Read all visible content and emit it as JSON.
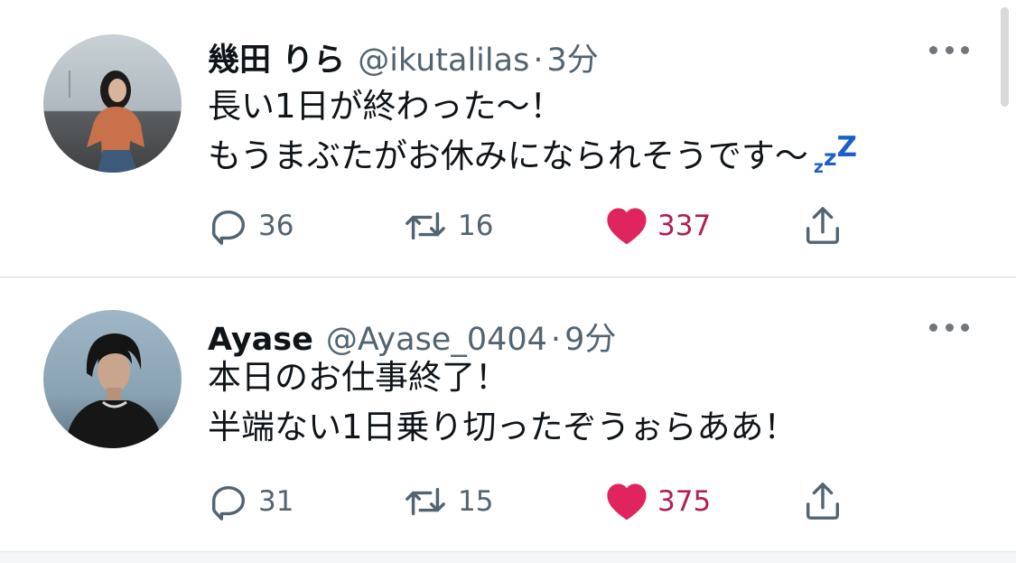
{
  "colors": {
    "like": "#e0245e",
    "like_count": "#b01e55",
    "zzz": "#1d5fc9",
    "secondary_text": "#536471"
  },
  "tweets": [
    {
      "display_name": "幾田 りら",
      "handle": "@ikutalilas",
      "separator": "·",
      "time": "3分",
      "lines": [
        "長い1日が終わった〜！",
        "もうまぶたがお休みになられそうです〜"
      ],
      "emoji": "zzz-emoji",
      "replies": "36",
      "retweets": "16",
      "likes": "337",
      "liked": true
    },
    {
      "display_name": "Ayase",
      "handle": "@Ayase_0404",
      "separator": "·",
      "time": "9分",
      "lines": [
        "本日のお仕事終了！",
        "半端ない1日乗り切ったぞうぉらああ！"
      ],
      "replies": "31",
      "retweets": "15",
      "likes": "375",
      "liked": true
    }
  ]
}
